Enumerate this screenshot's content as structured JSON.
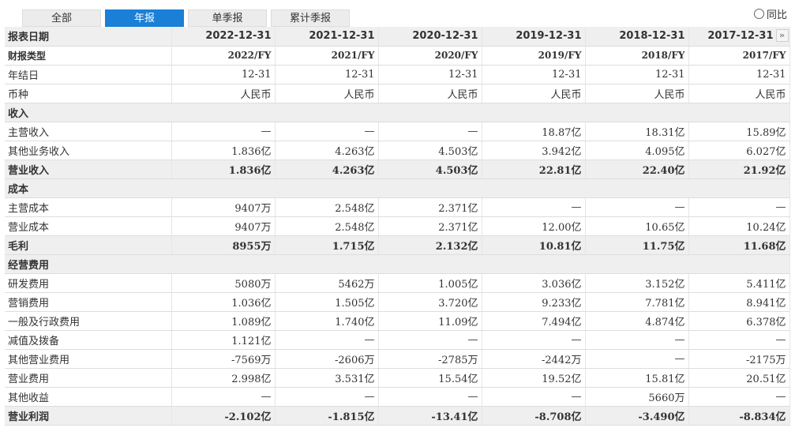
{
  "tabs": [
    "全部",
    "年报",
    "单季报",
    "累计季报"
  ],
  "active_tab": 1,
  "yoy_label": "同比",
  "header": {
    "first": "报表日期",
    "dates": [
      "2022-12-31",
      "2021-12-31",
      "2020-12-31",
      "2019-12-31",
      "2018-12-31",
      "2017-12-31"
    ]
  },
  "rows": [
    {
      "kind": "bold",
      "label": "财报类型",
      "values": [
        "2022/FY",
        "2021/FY",
        "2020/FY",
        "2019/FY",
        "2018/FY",
        "2017/FY"
      ]
    },
    {
      "kind": "normal",
      "label": "年结日",
      "values": [
        "12-31",
        "12-31",
        "12-31",
        "12-31",
        "12-31",
        "12-31"
      ]
    },
    {
      "kind": "normal",
      "label": "币种",
      "values": [
        "人民币",
        "人民币",
        "人民币",
        "人民币",
        "人民币",
        "人民币"
      ]
    },
    {
      "kind": "section",
      "label": "收入"
    },
    {
      "kind": "normal",
      "label": "主营收入",
      "values": [
        "—",
        "—",
        "—",
        "18.87亿",
        "18.31亿",
        "15.89亿"
      ]
    },
    {
      "kind": "normal",
      "label": "其他业务收入",
      "values": [
        "1.836亿",
        "4.263亿",
        "4.503亿",
        "3.942亿",
        "4.095亿",
        "6.027亿"
      ]
    },
    {
      "kind": "total",
      "label": "营业收入",
      "values": [
        "1.836亿",
        "4.263亿",
        "4.503亿",
        "22.81亿",
        "22.40亿",
        "21.92亿"
      ]
    },
    {
      "kind": "section",
      "label": "成本"
    },
    {
      "kind": "normal",
      "label": "主营成本",
      "values": [
        "9407万",
        "2.548亿",
        "2.371亿",
        "—",
        "—",
        "—"
      ]
    },
    {
      "kind": "normal",
      "label": "营业成本",
      "values": [
        "9407万",
        "2.548亿",
        "2.371亿",
        "12.00亿",
        "10.65亿",
        "10.24亿"
      ]
    },
    {
      "kind": "total",
      "label": "毛利",
      "values": [
        "8955万",
        "1.715亿",
        "2.132亿",
        "10.81亿",
        "11.75亿",
        "11.68亿"
      ]
    },
    {
      "kind": "section",
      "label": "经营费用"
    },
    {
      "kind": "normal",
      "label": "研发费用",
      "values": [
        "5080万",
        "5462万",
        "1.005亿",
        "3.036亿",
        "3.152亿",
        "5.411亿"
      ]
    },
    {
      "kind": "normal",
      "label": "营销费用",
      "values": [
        "1.036亿",
        "1.505亿",
        "3.720亿",
        "9.233亿",
        "7.781亿",
        "8.941亿"
      ]
    },
    {
      "kind": "normal",
      "label": "一般及行政费用",
      "values": [
        "1.089亿",
        "1.740亿",
        "11.09亿",
        "7.494亿",
        "4.874亿",
        "6.378亿"
      ]
    },
    {
      "kind": "normal",
      "label": "减值及拨备",
      "values": [
        "1.121亿",
        "—",
        "—",
        "—",
        "—",
        "—"
      ]
    },
    {
      "kind": "normal",
      "label": "其他营业费用",
      "values": [
        "-7569万",
        "-2606万",
        "-2785万",
        "-2442万",
        "—",
        "-2175万"
      ]
    },
    {
      "kind": "normal",
      "label": "营业费用",
      "values": [
        "2.998亿",
        "3.531亿",
        "15.54亿",
        "19.52亿",
        "15.81亿",
        "20.51亿"
      ]
    },
    {
      "kind": "normal",
      "label": "其他收益",
      "values": [
        "—",
        "—",
        "—",
        "—",
        "5660万",
        "—"
      ]
    },
    {
      "kind": "total",
      "label": "营业利润",
      "values": [
        "-2.102亿",
        "-1.815亿",
        "-13.41亿",
        "-8.708亿",
        "-3.490亿",
        "-8.834亿"
      ]
    }
  ],
  "more_icon": "double-chevron-right-icon",
  "colors": {
    "accent": "#1a7fd6",
    "header_bg": "#efefef"
  }
}
